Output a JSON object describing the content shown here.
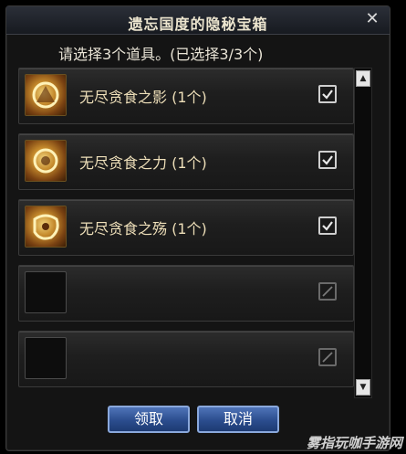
{
  "window": {
    "title": "遗忘国度的隐秘宝箱",
    "close_label": "✕"
  },
  "prompt": "请选择3个道具。(已选择3/3个)",
  "slots": [
    {
      "name": "无尽贪食之影 (1个)",
      "checked": true
    },
    {
      "name": "无尽贪食之力 (1个)",
      "checked": true
    },
    {
      "name": "无尽贪食之殇 (1个)",
      "checked": true
    },
    {
      "name": "",
      "checked": false
    },
    {
      "name": "",
      "checked": false
    }
  ],
  "scrollbar": {
    "up_label": "▲",
    "down_label": "▼"
  },
  "buttons": {
    "confirm_label": "领取",
    "cancel_label": "取消"
  },
  "watermark": "雾指玩咖手游网"
}
